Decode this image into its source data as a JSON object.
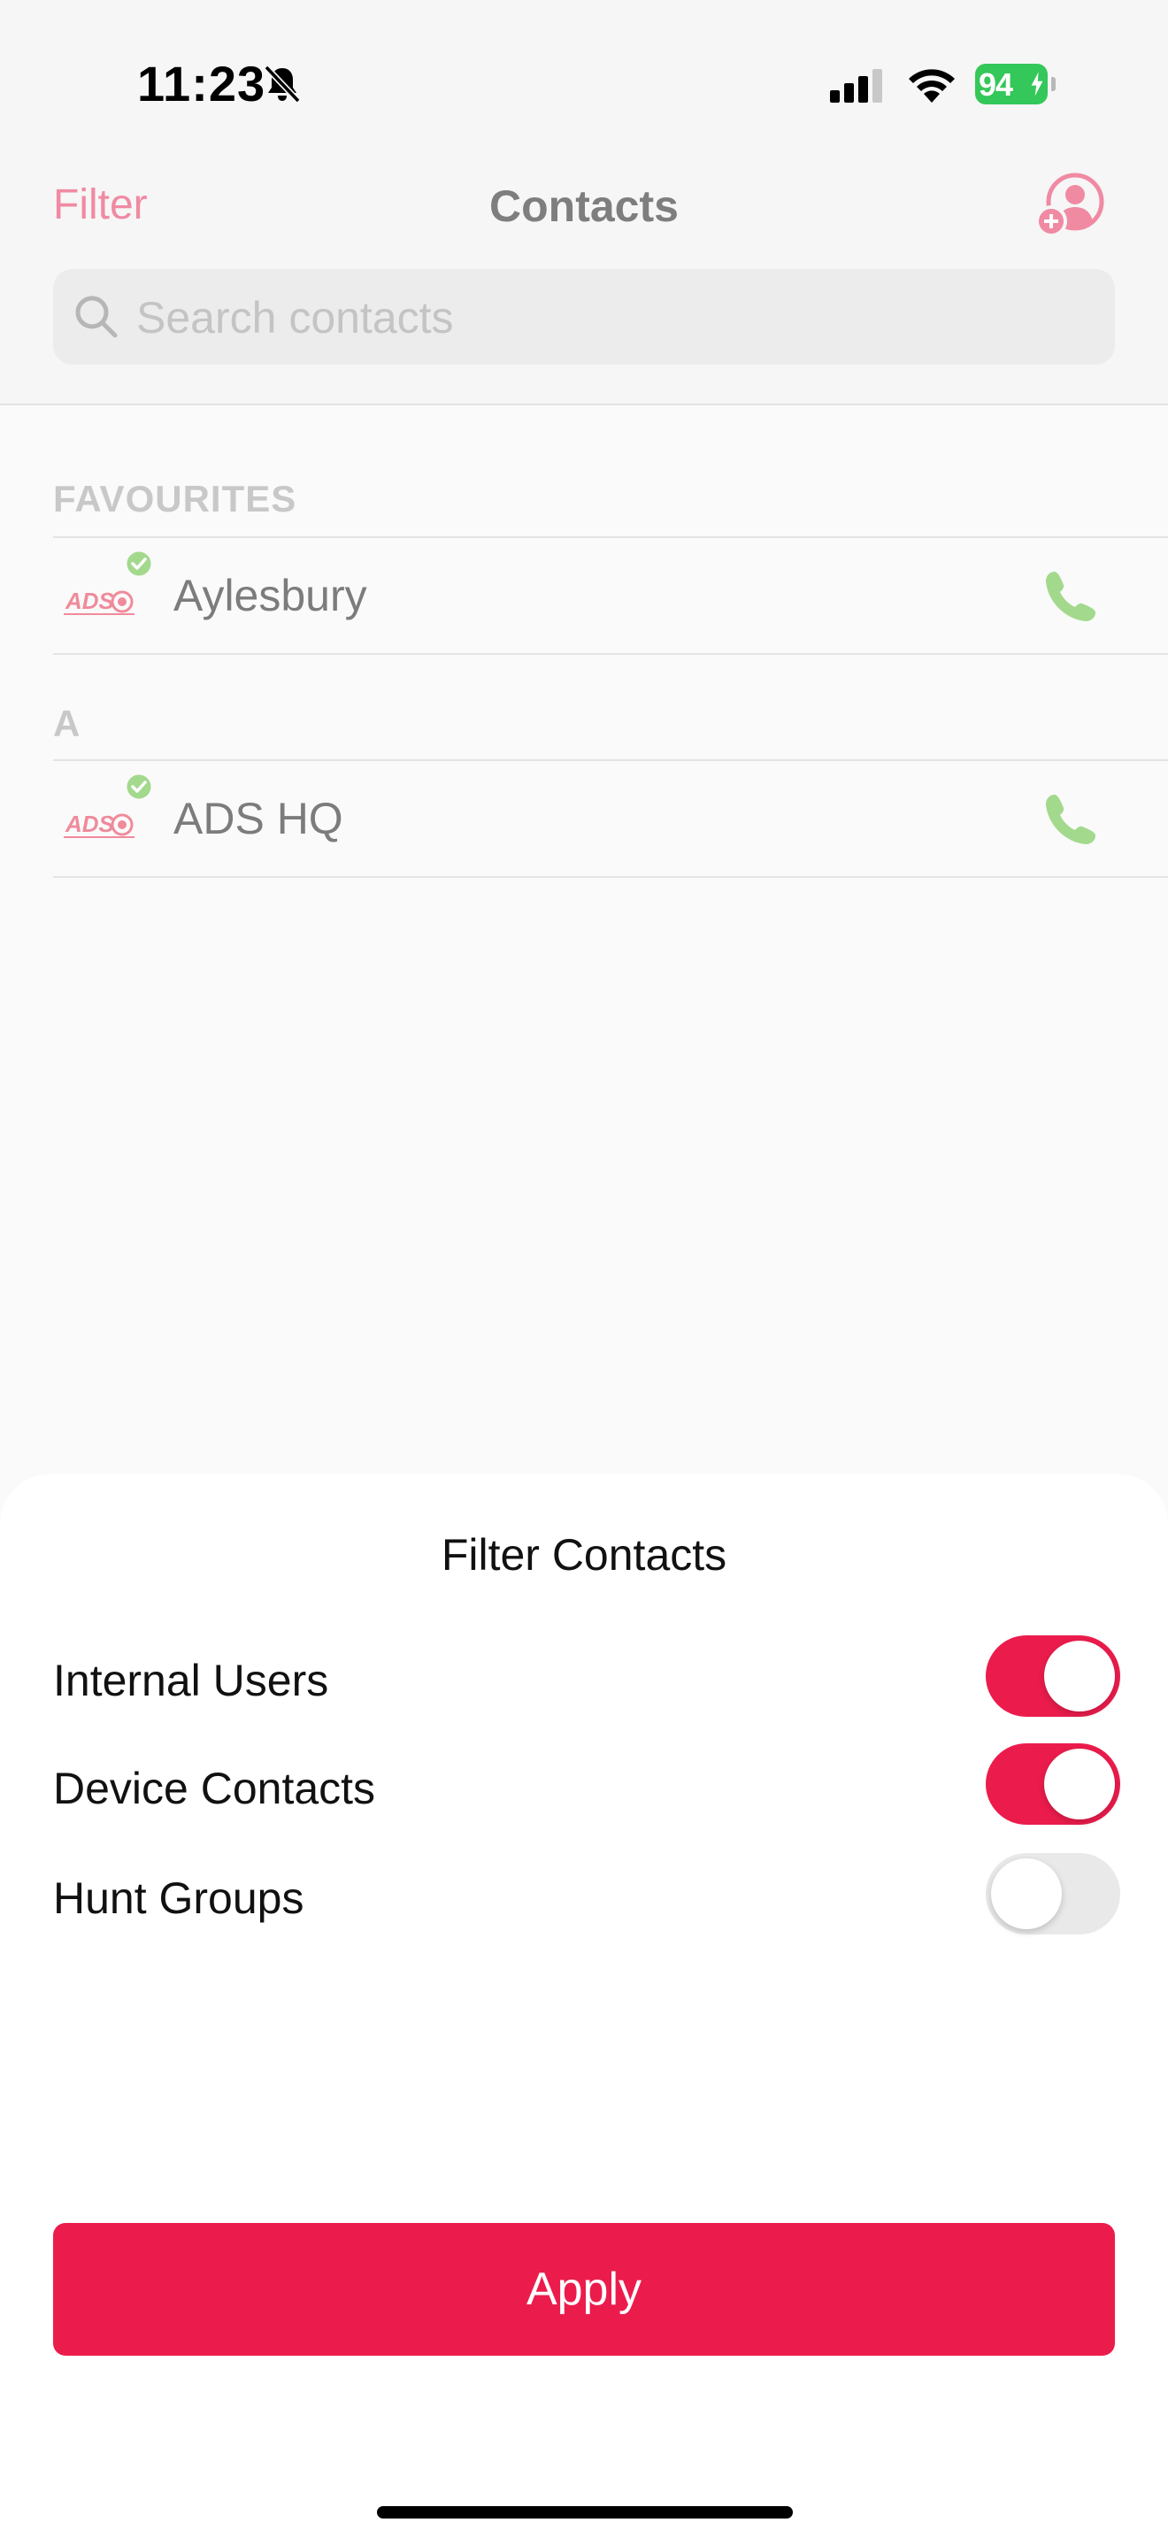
{
  "status_bar": {
    "time": "11:23",
    "battery": "94",
    "battery_color": "#34c759",
    "icons": [
      "bell-slash-icon",
      "signal-icon",
      "wifi-icon",
      "battery-icon"
    ]
  },
  "nav": {
    "filter_label": "Filter",
    "title": "Contacts",
    "add_contact_icon": "add-contact-icon",
    "accent_color": "#f08aa3"
  },
  "search": {
    "placeholder": "Search contacts",
    "value": ""
  },
  "contacts": {
    "sections": [
      {
        "header": "FAVOURITES",
        "items": [
          {
            "name": "Aylesbury",
            "avatar": "ads-logo",
            "status": "online",
            "action_icon": "phone-icon"
          }
        ]
      },
      {
        "header": "A",
        "items": [
          {
            "name": "ADS HQ",
            "avatar": "ads-logo",
            "status": "online",
            "action_icon": "phone-icon"
          }
        ]
      }
    ],
    "avatar_text": "ADS",
    "call_color": "#a3d98d"
  },
  "filter_sheet": {
    "title": "Filter Contacts",
    "options": [
      {
        "label": "Internal Users",
        "enabled": true
      },
      {
        "label": "Device Contacts",
        "enabled": true
      },
      {
        "label": "Hunt Groups",
        "enabled": false
      }
    ],
    "apply_label": "Apply",
    "accent_color": "#eb1c4c"
  }
}
